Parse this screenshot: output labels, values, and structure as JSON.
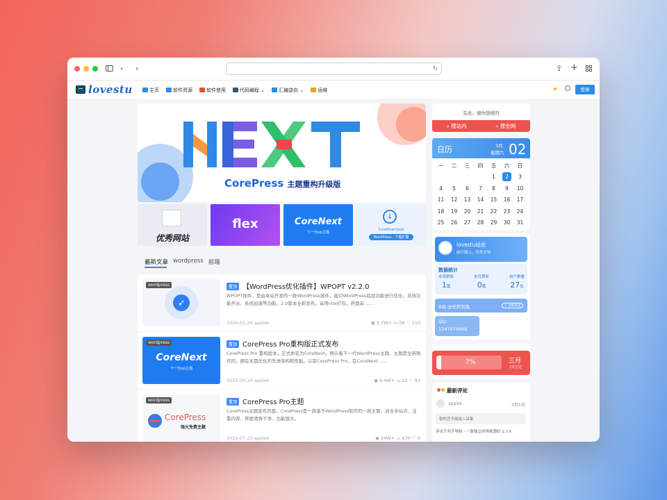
{
  "browser": {
    "toolbar": "browser toolbar"
  },
  "site": {
    "logo": "lovestu",
    "login": "登录",
    "nav": [
      {
        "label": "主页",
        "icon": "home-icon",
        "color": "#2f8ae5"
      },
      {
        "label": "软件资源",
        "icon": "bar-icon",
        "color": "#2f8ae5"
      },
      {
        "label": "软件使用",
        "icon": "apps-icon",
        "color": "#e25234"
      },
      {
        "label": "代码编程",
        "icon": "code-icon",
        "color": "#3b5370"
      },
      {
        "label": "汇编逆向",
        "icon": "shield-icon",
        "color": "#2f8ae5"
      },
      {
        "label": "运维",
        "icon": "linux-icon",
        "color": "#e2a528"
      }
    ]
  },
  "banner": {
    "title": "CorePress",
    "subtitle": "主题重构升级版",
    "big": "NEXT"
  },
  "thumbs": [
    {
      "label": "优秀网站"
    },
    {
      "label": "flex"
    },
    {
      "label": "CoreNext",
      "sub": "下一代wp主题"
    },
    {
      "label": "CoreDownload",
      "sub": "WordPress · 下载扩展"
    }
  ],
  "tabs": [
    "最新文章",
    "wordpress",
    "前端"
  ],
  "posts": [
    {
      "tag": "wordpress",
      "badge": "置顶",
      "title": "【WordPress优化插件】WPOPT v2.2.0",
      "desc": "WPOPT插件，是由本站开发的一款WordPress插件，能对WordPress底层功能进行优化、支持功能开关、系统加速等功能。2.0版本全新发布，采用vite打包，界面采……",
      "date": "2024-01-28",
      "author": "applek",
      "views": "3.7W+",
      "comments": "56",
      "likes": "113"
    },
    {
      "tag": "wordpress",
      "badge": "置顶",
      "title": "CorePress Pro重构版正式发布",
      "desc": "CorePress Pro 重构版本，正式命名为CoreNext，预示着下一代WordPress主题。主题是全新制作的，拥有无需优化的先进架构和性能。以前CorePress Pro，在CoreNext……",
      "date": "2023-09-26",
      "author": "applek",
      "views": "9.4W+",
      "comments": "22",
      "likes": "93",
      "img_title": "CoreNext",
      "img_sub": "下一代wp主题"
    },
    {
      "tag": "wordpress",
      "badge": "置顶",
      "title": "CorePress Pro主题",
      "desc": "CorePress主题发布页面，CorePress是一款基于WordPress制作的一款主题，适合多站点、注重内容、界面清爽干净、功能强大。",
      "date": "2022-07-22",
      "author": "applek",
      "views": "24W+",
      "comments": "670",
      "likes": "0",
      "img_title": "CorePress",
      "img_sub": "强大免费主题"
    }
  ],
  "search": {
    "hint": "在此，搜你想搜的",
    "in_site": "搜站内",
    "all_web": "搜全网"
  },
  "calendar": {
    "title": "日历",
    "month": "3月",
    "weekday": "星期六",
    "day": "02",
    "week": [
      "一",
      "二",
      "三",
      "四",
      "五",
      "六",
      "日"
    ],
    "rows": [
      [
        "",
        "",
        "",
        "",
        "1",
        "2",
        "3"
      ],
      [
        "4",
        "5",
        "6",
        "7",
        "8",
        "9",
        "10"
      ],
      [
        "11",
        "12",
        "13",
        "14",
        "15",
        "16",
        "17"
      ],
      [
        "18",
        "19",
        "20",
        "21",
        "22",
        "23",
        "24"
      ],
      [
        "25",
        "26",
        "27",
        "28",
        "29",
        "30",
        "31"
      ]
    ],
    "today": "2"
  },
  "profile": {
    "name": "lovestu站长",
    "motto": "前行路上，至死方休",
    "stats_title": "数据统计",
    "stats": [
      {
        "label": "本周更新",
        "value": "1",
        "unit": "篇"
      },
      {
        "label": "本月更新",
        "value": "0",
        "unit": "篇"
      },
      {
        "label": "用户数量",
        "value": "27",
        "unit": "位"
      }
    ],
    "bili": "B站 @乐积刘兔",
    "bili_btn": "+ 立即关注",
    "qq_label": "QQ:",
    "qq": "1247079966"
  },
  "progress": {
    "percent": "7%",
    "value": 0.07,
    "month": "三月",
    "note": "2天已过"
  },
  "comments": {
    "title": "最新评论",
    "user": "applek",
    "date": "3月1日",
    "text": "暂时还不能接入采集",
    "ref": "评论于鸿子导航 - 一款独立的导航源码 1.3.6"
  },
  "colors": {
    "accent": "#2f8ae5",
    "red": "#ef5350",
    "bg": "#f4f5f7"
  }
}
